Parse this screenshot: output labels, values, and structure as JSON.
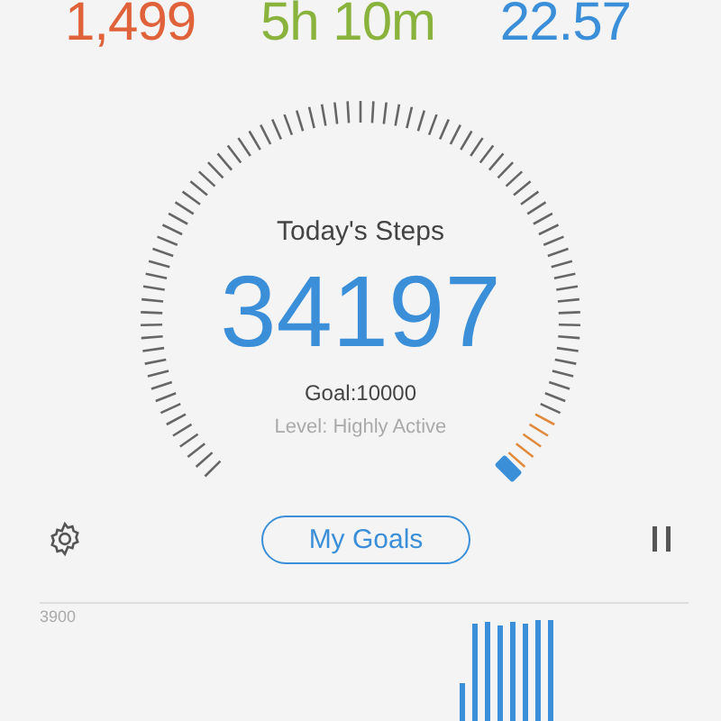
{
  "stats": [
    {
      "value": "1,499",
      "color": "#e0623a"
    },
    {
      "value": "5h 10m",
      "color": "#8ab33e"
    },
    {
      "value": "22.57",
      "color": "#3b8fd9"
    }
  ],
  "gauge": {
    "title": "Today's Steps",
    "steps": "34197",
    "goal": "Goal:10000",
    "level_text": "Level: Highly Active"
  },
  "actions": {
    "button": "My Goals"
  },
  "chart": {
    "y_label": "3900"
  }
}
